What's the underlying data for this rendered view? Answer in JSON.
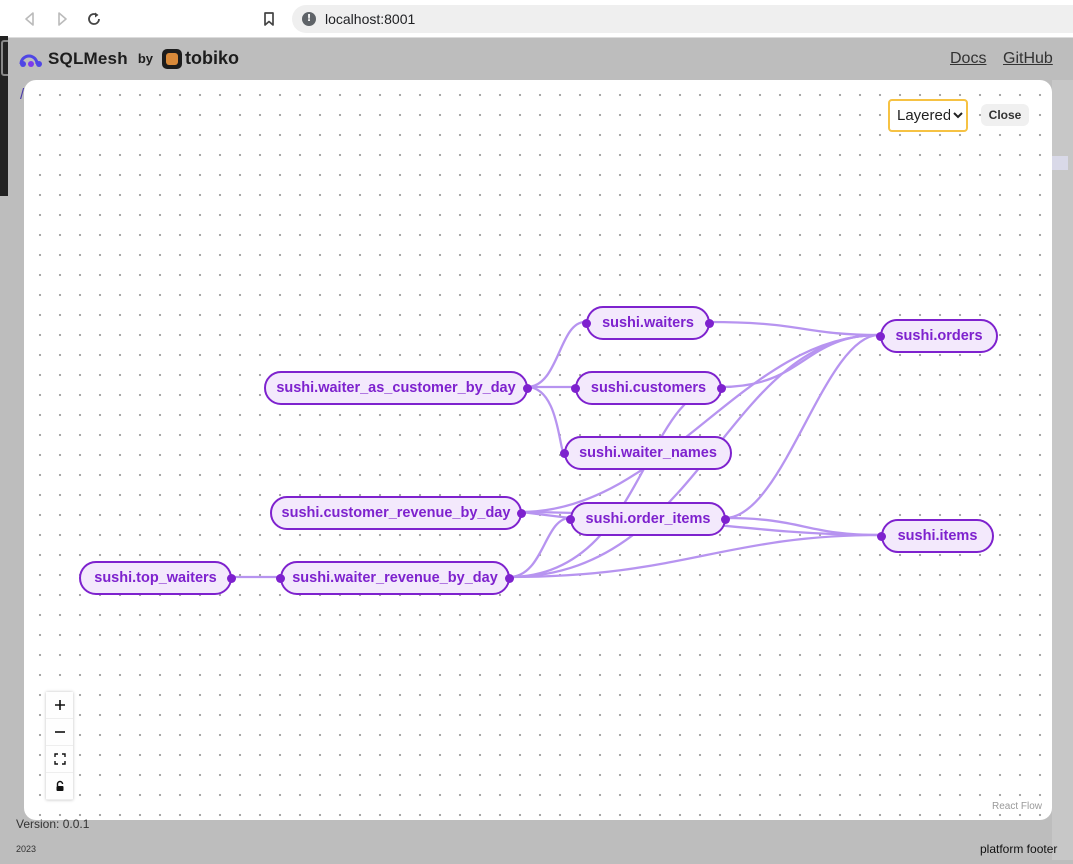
{
  "browser": {
    "url": "localhost:8001"
  },
  "header": {
    "logo_text": "SQLMesh",
    "by_label": "by",
    "partner_name": "tobiko",
    "docs_link": "Docs",
    "github_link": "GitHub"
  },
  "breadcrumb": "/",
  "lineage": {
    "layout_options": [
      "Layered"
    ],
    "layout_selected": "Layered",
    "close_label": "Close",
    "nodes": [
      {
        "id": "waiters",
        "label": "sushi.waiters"
      },
      {
        "id": "orders",
        "label": "sushi.orders"
      },
      {
        "id": "waiter_as_customer_by_day",
        "label": "sushi.waiter_as_customer_by_day"
      },
      {
        "id": "customers",
        "label": "sushi.customers"
      },
      {
        "id": "waiter_names",
        "label": "sushi.waiter_names"
      },
      {
        "id": "customer_revenue_by_day",
        "label": "sushi.customer_revenue_by_day"
      },
      {
        "id": "order_items",
        "label": "sushi.order_items"
      },
      {
        "id": "items",
        "label": "sushi.items"
      },
      {
        "id": "top_waiters",
        "label": "sushi.top_waiters"
      },
      {
        "id": "waiter_revenue_by_day",
        "label": "sushi.waiter_revenue_by_day"
      }
    ],
    "edges": [
      [
        "waiter_as_customer_by_day",
        "waiters"
      ],
      [
        "waiter_as_customer_by_day",
        "customers"
      ],
      [
        "waiter_as_customer_by_day",
        "waiter_names"
      ],
      [
        "waiters",
        "orders"
      ],
      [
        "customers",
        "orders"
      ],
      [
        "order_items",
        "orders"
      ],
      [
        "order_items",
        "items"
      ],
      [
        "customer_revenue_by_day",
        "order_items"
      ],
      [
        "customer_revenue_by_day",
        "orders"
      ],
      [
        "customer_revenue_by_day",
        "items"
      ],
      [
        "waiter_revenue_by_day",
        "order_items"
      ],
      [
        "waiter_revenue_by_day",
        "orders"
      ],
      [
        "waiter_revenue_by_day",
        "items"
      ],
      [
        "waiter_revenue_by_day",
        "customers"
      ],
      [
        "top_waiters",
        "waiter_revenue_by_day"
      ]
    ],
    "controls": [
      "zoom-in-icon",
      "zoom-out-icon",
      "fit-view-icon",
      "lock-icon"
    ],
    "attribution": "React Flow",
    "accent_color": "#7e22ce",
    "edge_color": "#b794f0"
  },
  "footer": {
    "version": "Version: 0.0.1",
    "year": "2023",
    "text": "platform footer"
  }
}
